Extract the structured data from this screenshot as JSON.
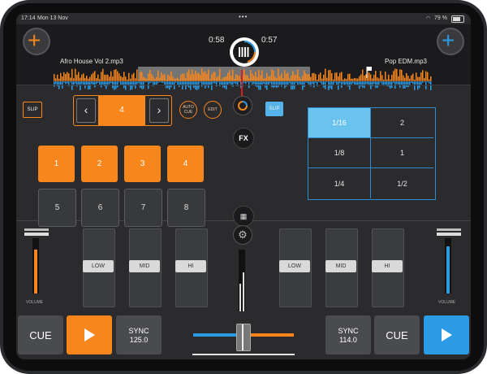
{
  "status_bar": {
    "time": "17:14",
    "date": "Mon 13 Nov",
    "battery": "79 %"
  },
  "deck_left": {
    "track": "Afro House Vol 2.mp3",
    "time": "0:58",
    "add_symbol": "+",
    "slip_label": "SLIP",
    "loop_value": "4",
    "prev_arrow": "‹",
    "next_arrow": "›",
    "auto_cue_label": "AUTO\nCUE",
    "edit_label": "EDIT",
    "pads_top": [
      "1",
      "2",
      "3",
      "4"
    ],
    "pads_bottom": [
      "5",
      "6",
      "7",
      "8"
    ]
  },
  "deck_right": {
    "track": "Pop EDM.mp3",
    "time": "0:57",
    "add_symbol": "+",
    "slip_label": "SLIP",
    "loop_grid": [
      "1/16",
      "2",
      "1/8",
      "1",
      "1/4",
      "1/2"
    ],
    "selected_loop": "1/16"
  },
  "center": {
    "fx_label": "FX",
    "settings_icon": "gear-icon",
    "grid_icon": "grid-icon",
    "sync_icon": "sync-icon"
  },
  "mixer": {
    "volume_label_left": "VOLUME",
    "volume_label_right": "VOLUME",
    "eq_left": [
      "LOW",
      "MID",
      "HI"
    ],
    "eq_right": [
      "LOW",
      "MID",
      "HI"
    ]
  },
  "transport_left": {
    "cue_label": "CUE",
    "play_icon": "play-icon",
    "sync_label": "SYNC",
    "bpm": "125.0"
  },
  "transport_right": {
    "cue_label": "CUE",
    "play_icon": "play-icon",
    "sync_label": "SYNC",
    "bpm": "114.0"
  },
  "colors": {
    "left_accent": "#f7861d",
    "right_accent": "#2b9be6",
    "selected_cell": "#6ac3ee"
  }
}
